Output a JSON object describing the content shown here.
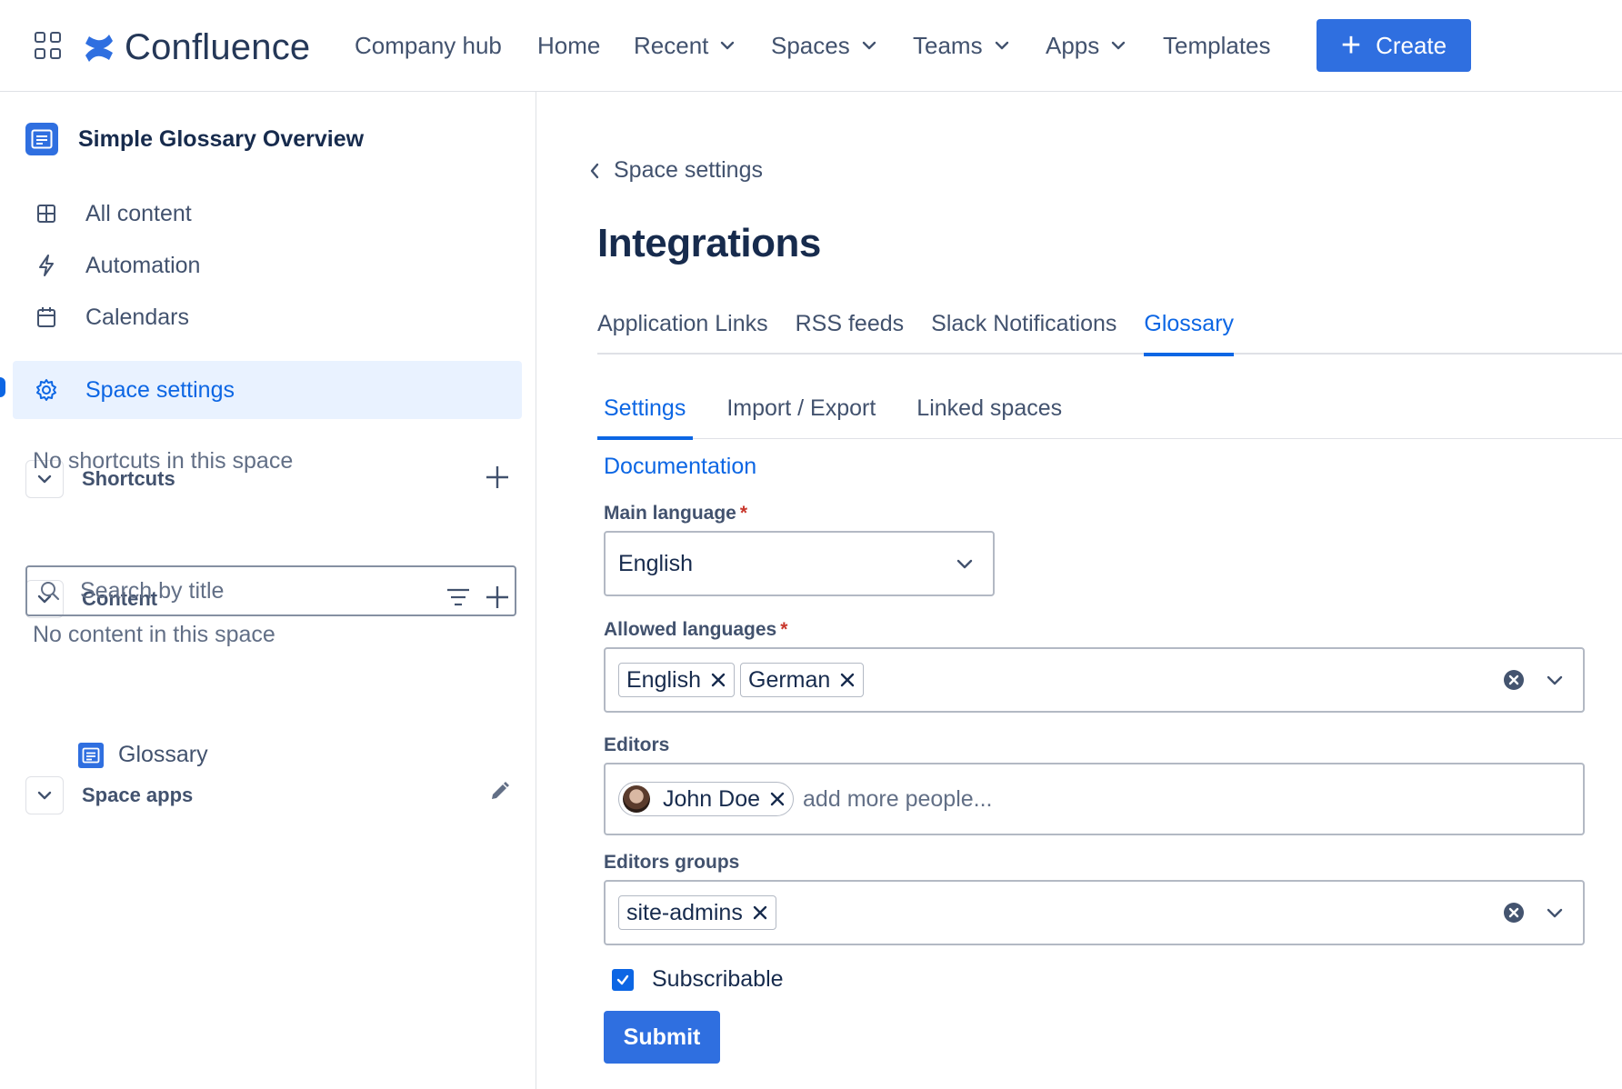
{
  "topnav": {
    "logo_text": "Confluence",
    "items": [
      {
        "label": "Company hub"
      },
      {
        "label": "Home"
      },
      {
        "label": "Recent"
      },
      {
        "label": "Spaces"
      },
      {
        "label": "Teams"
      },
      {
        "label": "Apps"
      },
      {
        "label": "Templates"
      }
    ],
    "create_label": "Create"
  },
  "sidebar": {
    "space_title": "Simple Glossary Overview",
    "links": [
      {
        "label": "All content",
        "icon": "grid-icon"
      },
      {
        "label": "Automation",
        "icon": "lightning-icon"
      },
      {
        "label": "Calendars",
        "icon": "calendar-icon"
      },
      {
        "label": "Space settings",
        "icon": "gear-icon",
        "active": true
      }
    ],
    "shortcuts": {
      "title": "Shortcuts",
      "empty": "No shortcuts in this space"
    },
    "content": {
      "title": "Content",
      "search_placeholder": "Search by title",
      "empty": "No content in this space"
    },
    "space_apps": {
      "title": "Space apps",
      "items": [
        {
          "label": "Glossary"
        }
      ]
    }
  },
  "main": {
    "back_label": "Space settings",
    "title": "Integrations",
    "tabs": [
      {
        "label": "Application Links"
      },
      {
        "label": "RSS feeds"
      },
      {
        "label": "Slack Notifications"
      },
      {
        "label": "Glossary",
        "active": true
      }
    ],
    "subtabs": [
      {
        "label": "Settings",
        "active": true
      },
      {
        "label": "Import / Export"
      },
      {
        "label": "Linked spaces"
      }
    ],
    "documentation_link": "Documentation",
    "form": {
      "main_language": {
        "label": "Main language",
        "required_mark": "*",
        "value": "English"
      },
      "allowed_languages": {
        "label": "Allowed languages",
        "required_mark": "*",
        "values": [
          "English",
          "German"
        ]
      },
      "editors": {
        "label": "Editors",
        "values": [
          "John Doe"
        ],
        "placeholder": "add more people..."
      },
      "editors_groups": {
        "label": "Editors groups",
        "values": [
          "site-admins"
        ]
      },
      "subscribable": {
        "label": "Subscribable",
        "checked": true
      },
      "submit_label": "Submit"
    }
  },
  "colors": {
    "accent": "#0c66e4",
    "button": "#2f6fe0",
    "required": "#c9372c"
  }
}
